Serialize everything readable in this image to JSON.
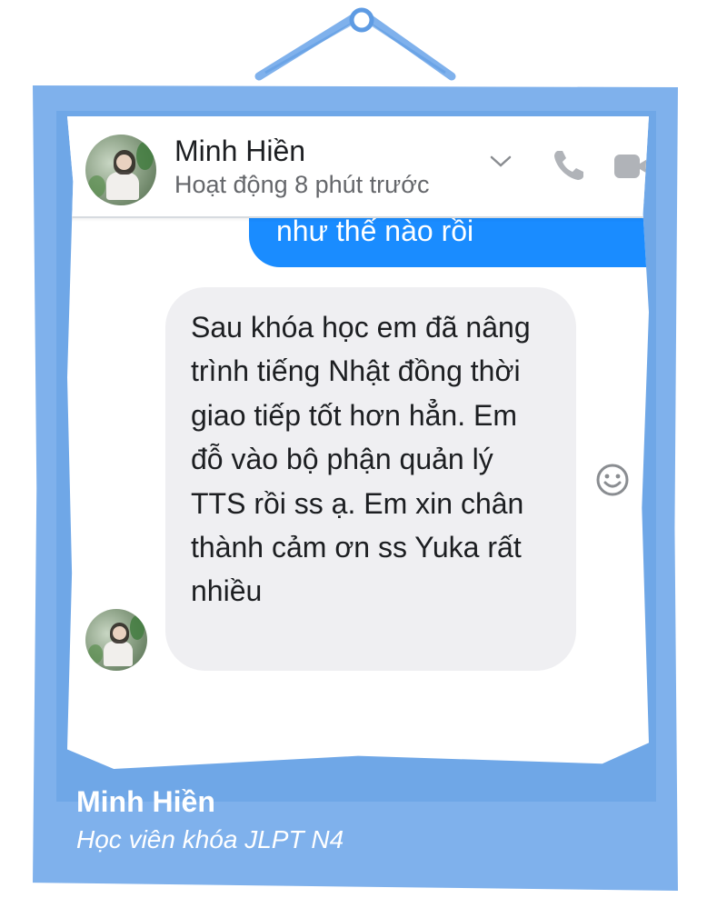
{
  "colors": {
    "frame": "#7fb1ec",
    "messenger_blue": "#1a8cff",
    "bubble_gray": "#efeff2",
    "text_dark": "#1c1e21",
    "text_muted": "#65676b"
  },
  "header": {
    "name": "Minh Hiền",
    "status": "Hoạt động 8 phút trước",
    "icons": [
      "chevron-down-icon",
      "phone-icon",
      "video-camera-icon"
    ]
  },
  "messages": {
    "sent_partial": "như thế nào rồi",
    "received": "Sau khóa học em đã nâng trình tiếng Nhật đồng thời giao tiếp tốt hơn hẳn. Em đỗ vào bộ phận quản lý TTS rồi ss ạ. Em xin chân thành cảm ơn ss Yuka rất nhiều"
  },
  "caption": {
    "name": "Minh Hiền",
    "role": "Học viên khóa JLPT N4"
  }
}
